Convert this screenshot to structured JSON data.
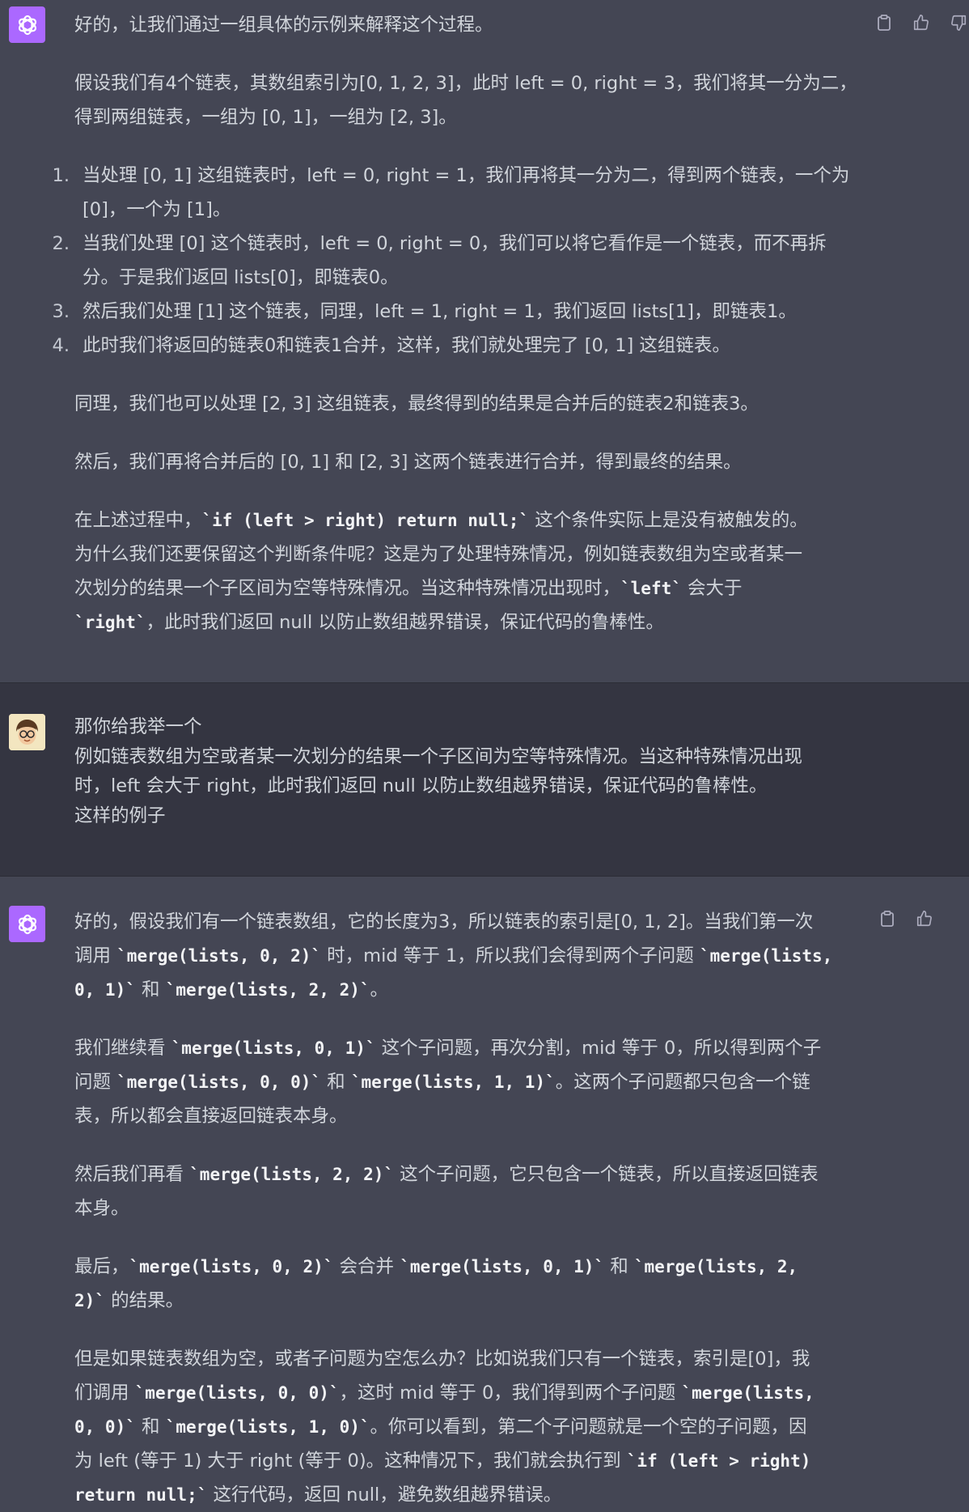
{
  "messages": [
    {
      "role": "assistant",
      "avatar_icon": "openai-logo-icon",
      "paragraphs": [
        "好的，让我们通过一组具体的示例来解释这个过程。",
        "假设我们有4个链表，其数组索引为[0, 1, 2, 3]，此时 left = 0, right = 3，我们将其一分为二，\n得到两组链表，一组为 [0, 1]，一组为 [2, 3]。"
      ],
      "list": [
        {
          "num": "1.",
          "text": "当处理 [0, 1] 这组链表时，left = 0, right = 1，我们再将其一分为二，得到两个链表，一个为\n[0]，一个为 [1]。"
        },
        {
          "num": "2.",
          "text": "当我们处理 [0] 这个链表时，left = 0, right = 0，我们可以将它看作是一个链表，而不再拆\n分。于是我们返回 lists[0]，即链表0。"
        },
        {
          "num": "3.",
          "text": "然后我们处理 [1] 这个链表，同理，left = 1, right = 1，我们返回 lists[1]，即链表1。"
        },
        {
          "num": "4.",
          "text": "此时我们将返回的链表0和链表1合并，这样，我们就处理完了 [0, 1] 这组链表。"
        }
      ],
      "after_list": [
        "同理，我们也可以处理 [2, 3] 这组链表，最终得到的结果是合并后的链表2和链表3。",
        "然后，我们再将合并后的 [0, 1] 和 [2, 3] 这两个链表进行合并，得到最终的结果。"
      ],
      "last": {
        "t1": "在上述过程中，",
        "c1": "`if (left > right) return null;`",
        "t2": " 这个条件实际上是没有被触发的。\n为什么我们还要保留这个判断条件呢？这是为了处理特殊情况，例如链表数组为空或者某一\n次划分的结果一个子区间为空等特殊情况。当这种特殊情况出现时，",
        "c2": "`left`",
        "t3": " 会大于\n",
        "c3": "`right`",
        "t4": "，此时我们返回 null 以防止数组越界错误，保证代码的鲁棒性。"
      }
    },
    {
      "role": "user",
      "avatar_icon": "user-avatar-icon",
      "text": "那你给我举一个\n例如链表数组为空或者某一次划分的结果一个子区间为空等特殊情况。当这种特殊情况出现\n时，left 会大于 right，此时我们返回 null 以防止数组越界错误，保证代码的鲁棒性。\n这样的例子"
    },
    {
      "role": "assistant",
      "avatar_icon": "openai-logo-icon",
      "p1": {
        "t1": "好的，假设我们有一个链表数组，它的长度为3，所以链表的索引是[0, 1, 2]。当我们第一次\n调用 ",
        "c1": "`merge(lists, 0, 2)`",
        "t2": " 时，mid 等于 1，所以我们会得到两个子问题 ",
        "c2": "`merge(lists,\n0, 1)`",
        "t3": " 和 ",
        "c3": "`merge(lists, 2, 2)`",
        "t4": "。"
      },
      "p2": {
        "t1": "我们继续看 ",
        "c1": "`merge(lists, 0, 1)`",
        "t2": " 这个子问题，再次分割，mid 等于 0，所以得到两个子\n问题 ",
        "c2": "`merge(lists, 0, 0)`",
        "t3": " 和 ",
        "c3": "`merge(lists, 1, 1)`",
        "t4": "。这两个子问题都只包含一个链\n表，所以都会直接返回链表本身。"
      },
      "p3": {
        "t1": "然后我们再看 ",
        "c1": "`merge(lists, 2, 2)`",
        "t2": " 这个子问题，它只包含一个链表，所以直接返回链表\n本身。"
      },
      "p4": {
        "t1": "最后，",
        "c1": "`merge(lists, 0, 2)`",
        "t2": " 会合并 ",
        "c2": "`merge(lists, 0, 1)`",
        "t3": " 和 ",
        "c3": "`merge(lists, 2,\n2)`",
        "t4": " 的结果。"
      },
      "p5": {
        "t1": "但是如果链表数组为空，或者子问题为空怎么办？比如说我们只有一个链表，索引是[0]，我\n们调用 ",
        "c1": "`merge(lists, 0, 0)`",
        "t2": "，这时 mid 等于 0，我们得到两个子问题 ",
        "c2": "`merge(lists,\n0, 0)`",
        "t3": " 和 ",
        "c3": "`merge(lists, 1, 0)`",
        "t4": "。你可以看到，第二个子问题就是一个空的子问题，因\n为 left (等于 1) 大于 right (等于 0)。这种情况下，我们就会执行到 ",
        "c4": "`if (left > right)\nreturn null;`",
        "t5": " 这行代码，返回 null，避免数组越界错误。"
      }
    }
  ],
  "actions": {
    "copy_icon": "clipboard-icon",
    "like_icon": "thumbs-up-icon",
    "dislike_icon": "thumbs-down-icon"
  }
}
